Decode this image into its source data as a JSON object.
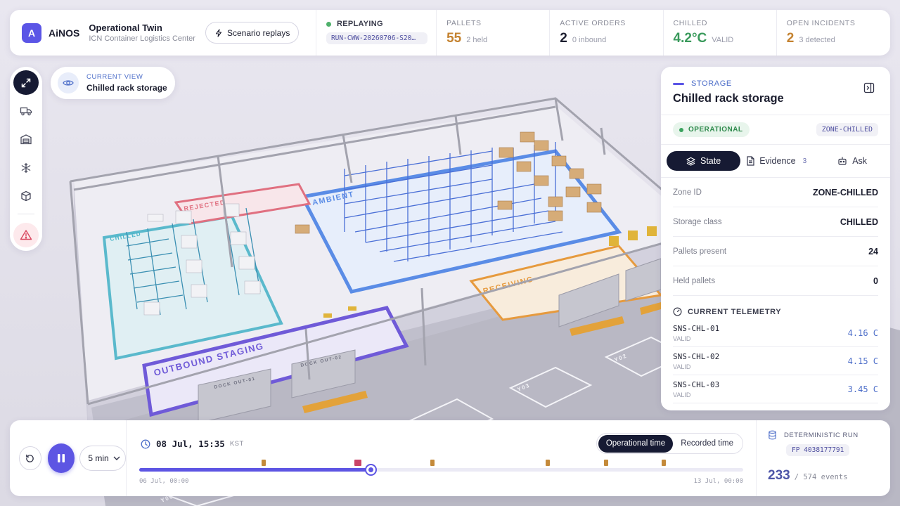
{
  "header": {
    "logo_letter": "A",
    "brand": "AiNOS",
    "app_title": "Operational Twin",
    "facility": "ICN Container Logistics Center",
    "scenario_button": "Scenario replays",
    "replay": {
      "label": "REPLAYING",
      "run_id": "RUN-CWW-20260706-S20…"
    },
    "stats": [
      {
        "key": "PALLETS",
        "value": "55",
        "sub": "2 held",
        "color": "#c4822f"
      },
      {
        "key": "ACTIVE ORDERS",
        "value": "2",
        "sub": "0 inbound",
        "color": "#1b1d2e"
      },
      {
        "key": "CHILLED",
        "value": "4.2°C",
        "sub": "VALID",
        "color": "#3a9a5c"
      },
      {
        "key": "OPEN INCIDENTS",
        "value": "2",
        "sub": "3 detected",
        "color": "#c4822f"
      }
    ]
  },
  "toolbar": {
    "items": [
      {
        "icon": "expand-icon",
        "active": true
      },
      {
        "icon": "truck-icon"
      },
      {
        "icon": "warehouse-icon"
      },
      {
        "icon": "snowflake-icon"
      },
      {
        "icon": "box-icon"
      },
      {
        "icon": "alert-icon"
      }
    ]
  },
  "current_view": {
    "label": "CURRENT VIEW",
    "value": "Chilled rack storage"
  },
  "scene": {
    "zones": {
      "rejected": "REJECTED",
      "ambient": "AMBIENT",
      "chilled": "CHILLED",
      "receiving": "RECEIVING",
      "outbound": "OUTBOUND STAGING"
    },
    "docks": {
      "dock1": "DOCK OUT-01",
      "dock2": "DOCK OUT-02"
    },
    "yards": {
      "y02": "Y02",
      "y03": "Y03",
      "y06": "Y06"
    }
  },
  "panel": {
    "category": "STORAGE",
    "title": "Chilled rack storage",
    "status": "OPERATIONAL",
    "zone_badge": "ZONE-CHILLED",
    "tabs": {
      "state": "State",
      "evidence": "Evidence",
      "evidence_count": "3",
      "ask": "Ask"
    },
    "rows": [
      {
        "key": "Zone ID",
        "value": "ZONE-CHILLED"
      },
      {
        "key": "Storage class",
        "value": "CHILLED"
      },
      {
        "key": "Pallets present",
        "value": "24"
      },
      {
        "key": "Held pallets",
        "value": "0"
      }
    ],
    "telemetry_title": "CURRENT TELEMETRY",
    "telemetry": [
      {
        "id": "SNS-CHL-01",
        "status": "VALID",
        "value": "4.16 C"
      },
      {
        "id": "SNS-CHL-02",
        "status": "VALID",
        "value": "4.15 C"
      },
      {
        "id": "SNS-CHL-03",
        "status": "VALID",
        "value": "3.45 C"
      }
    ]
  },
  "timeline": {
    "speed": "5 min",
    "current": "08 Jul, 15:35",
    "timezone": "KST",
    "toggle": {
      "operational": "Operational time",
      "recorded": "Recorded time"
    },
    "start": "06 Jul, 00:00",
    "end": "13 Jul, 00:00",
    "progress": 0.383,
    "markers": [
      {
        "pos": 0.206,
        "type": "event"
      },
      {
        "pos": 0.362,
        "type": "incident"
      },
      {
        "pos": 0.485,
        "type": "event"
      },
      {
        "pos": 0.676,
        "type": "event"
      },
      {
        "pos": 0.773,
        "type": "event"
      },
      {
        "pos": 0.868,
        "type": "event"
      }
    ]
  },
  "run": {
    "label": "DETERMINISTIC RUN",
    "fingerprint": "FP 4038177791",
    "events_done": "233",
    "events_total": "/ 574 events"
  }
}
